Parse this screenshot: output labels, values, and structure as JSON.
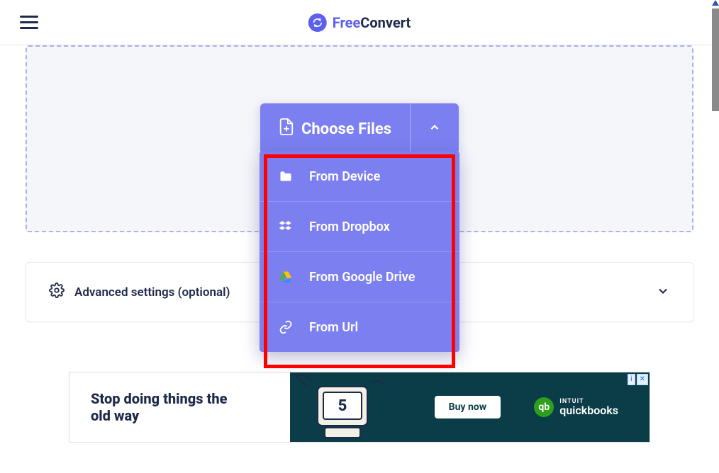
{
  "header": {
    "logo_free": "Free",
    "logo_convert": "Convert"
  },
  "upload": {
    "choose_label": "Choose Files",
    "options": [
      {
        "label": "From Device",
        "icon": "folder"
      },
      {
        "label": "From Dropbox",
        "icon": "dropbox"
      },
      {
        "label": "From Google Drive",
        "icon": "gdrive"
      },
      {
        "label": "From Url",
        "icon": "link"
      }
    ]
  },
  "advanced": {
    "label": "Advanced settings (optional)"
  },
  "ad": {
    "headline": "Stop doing things the old way",
    "cta": "Buy now",
    "brand_small": "INTUIT",
    "brand": "quickbooks",
    "illustration_number": "5",
    "info_icon": "i",
    "close_icon": "✕"
  }
}
